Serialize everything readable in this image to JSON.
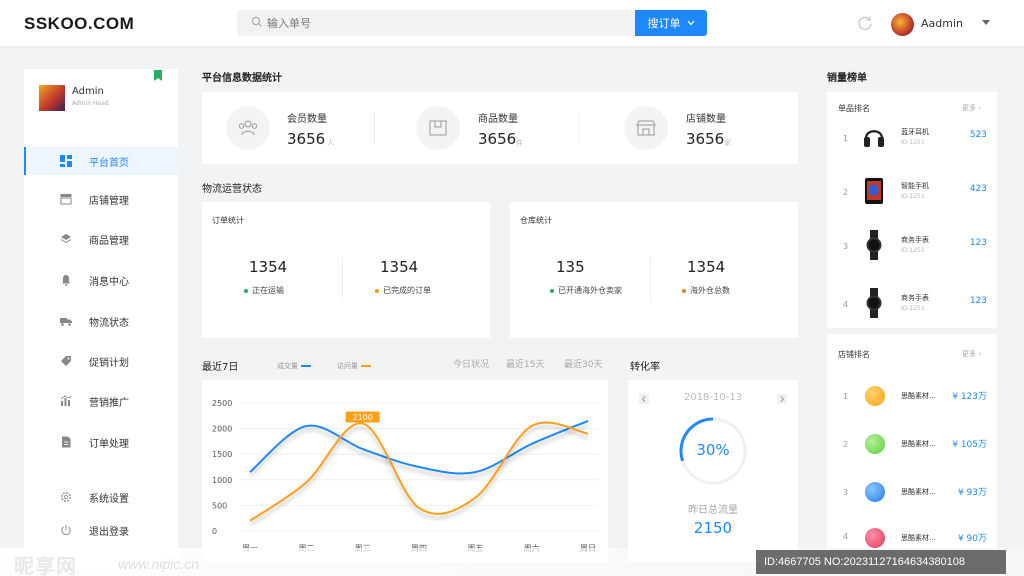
{
  "header": {
    "logo": "SSKOO.COM",
    "search_placeholder": "输入单号",
    "search_button": "搜订单",
    "user_name": "Aadmin"
  },
  "sidebar": {
    "user_name": "Admin",
    "user_sub": "Admin Head",
    "items": [
      {
        "label": "平台首页",
        "icon": "dashboard-icon",
        "active": true
      },
      {
        "label": "店铺管理",
        "icon": "store-icon"
      },
      {
        "label": "商品管理",
        "icon": "layers-icon"
      },
      {
        "label": "消息中心",
        "icon": "bell-icon"
      },
      {
        "label": "物流状态",
        "icon": "truck-icon"
      },
      {
        "label": "促销计划",
        "icon": "tag-icon"
      },
      {
        "label": "营销推广",
        "icon": "bar-chart-icon"
      },
      {
        "label": "订单处理",
        "icon": "document-icon"
      },
      {
        "label": "系统设置",
        "icon": "gear-icon"
      },
      {
        "label": "退出登录",
        "icon": "power-icon"
      }
    ]
  },
  "platform_stats": {
    "title": "平台信息数据统计",
    "items": [
      {
        "label": "会员数量",
        "value": "3656",
        "unit": "人",
        "icon": "members-icon"
      },
      {
        "label": "商品数量",
        "value": "3656",
        "unit": "件",
        "icon": "box-icon"
      },
      {
        "label": "店铺数量",
        "value": "3656",
        "unit": "家",
        "icon": "shop-icon"
      }
    ]
  },
  "logistics": {
    "title": "物流运营状态",
    "order_stats": {
      "title": "订单统计",
      "items": [
        {
          "value": "1354",
          "label": "正在运输",
          "color": "#27ae60"
        },
        {
          "value": "1354",
          "label": "已完成的订单",
          "color": "#f39c12"
        }
      ]
    },
    "warehouse_stats": {
      "title": "仓库统计",
      "items": [
        {
          "value": "135",
          "label": "已开通海外仓卖家",
          "color": "#27ae60"
        },
        {
          "value": "1354",
          "label": "海外仓总数",
          "color": "#e67e22"
        }
      ]
    }
  },
  "trend": {
    "title": "最近7日",
    "legend": [
      {
        "name": "成交量",
        "color": "#1e88ff"
      },
      {
        "name": "访问量",
        "color": "#ff9f1a"
      }
    ],
    "tabs": [
      "今日状况",
      "最近15天",
      "最近30天"
    ],
    "tooltip": "2100"
  },
  "chart_data": {
    "type": "line",
    "categories": [
      "周一",
      "周二",
      "周三",
      "周四",
      "周五",
      "周六",
      "周日"
    ],
    "ylim": [
      0,
      2500
    ],
    "yticks": [
      "0",
      "500",
      "1000",
      "1500",
      "2000",
      "2500"
    ],
    "grid": true,
    "series": [
      {
        "name": "成交量",
        "color": "#1e88ff",
        "values": [
          1150,
          2050,
          1600,
          1250,
          1150,
          1700,
          2150
        ]
      },
      {
        "name": "访问量",
        "color": "#ff9f1a",
        "values": [
          200,
          950,
          2100,
          450,
          650,
          2050,
          1900
        ]
      }
    ]
  },
  "conversion": {
    "title": "转化率",
    "date": "2018-10-13",
    "percent": "30%",
    "progress": 0.3,
    "flow_label": "昨日总流量",
    "flow_value": "2150"
  },
  "ranking": {
    "title": "销量榜单",
    "products": {
      "title": "单品排名",
      "more": "更多",
      "items": [
        {
          "rank": "1",
          "name": "蓝牙耳机",
          "id": "ID:1251",
          "value": "523",
          "icon": "headphones-icon"
        },
        {
          "rank": "2",
          "name": "智能手机",
          "id": "ID:1251",
          "value": "423",
          "icon": "smartphone-icon"
        },
        {
          "rank": "3",
          "name": "商务手表",
          "id": "ID:1251",
          "value": "123",
          "icon": "watch-icon"
        },
        {
          "rank": "4",
          "name": "商务手表",
          "id": "ID:1251",
          "value": "123",
          "icon": "watch-icon"
        }
      ]
    },
    "stores": {
      "title": "店铺排名",
      "more": "更多",
      "items": [
        {
          "rank": "1",
          "name": "思酷素材...",
          "value": "¥ 123万",
          "color": "#f7a21b"
        },
        {
          "rank": "2",
          "name": "思酷素材...",
          "value": "¥ 105万",
          "color": "#6fd64d"
        },
        {
          "rank": "3",
          "name": "思酷素材...",
          "value": "¥ 93万",
          "color": "#2a8ff7"
        },
        {
          "rank": "4",
          "name": "思酷素材...",
          "value": "¥ 90万",
          "color": "#e8416b"
        }
      ]
    }
  },
  "watermark": {
    "brand": "昵享网",
    "url": "www.nipic.cn",
    "id_text": "ID:4667705 NO:20231127164634380108"
  }
}
